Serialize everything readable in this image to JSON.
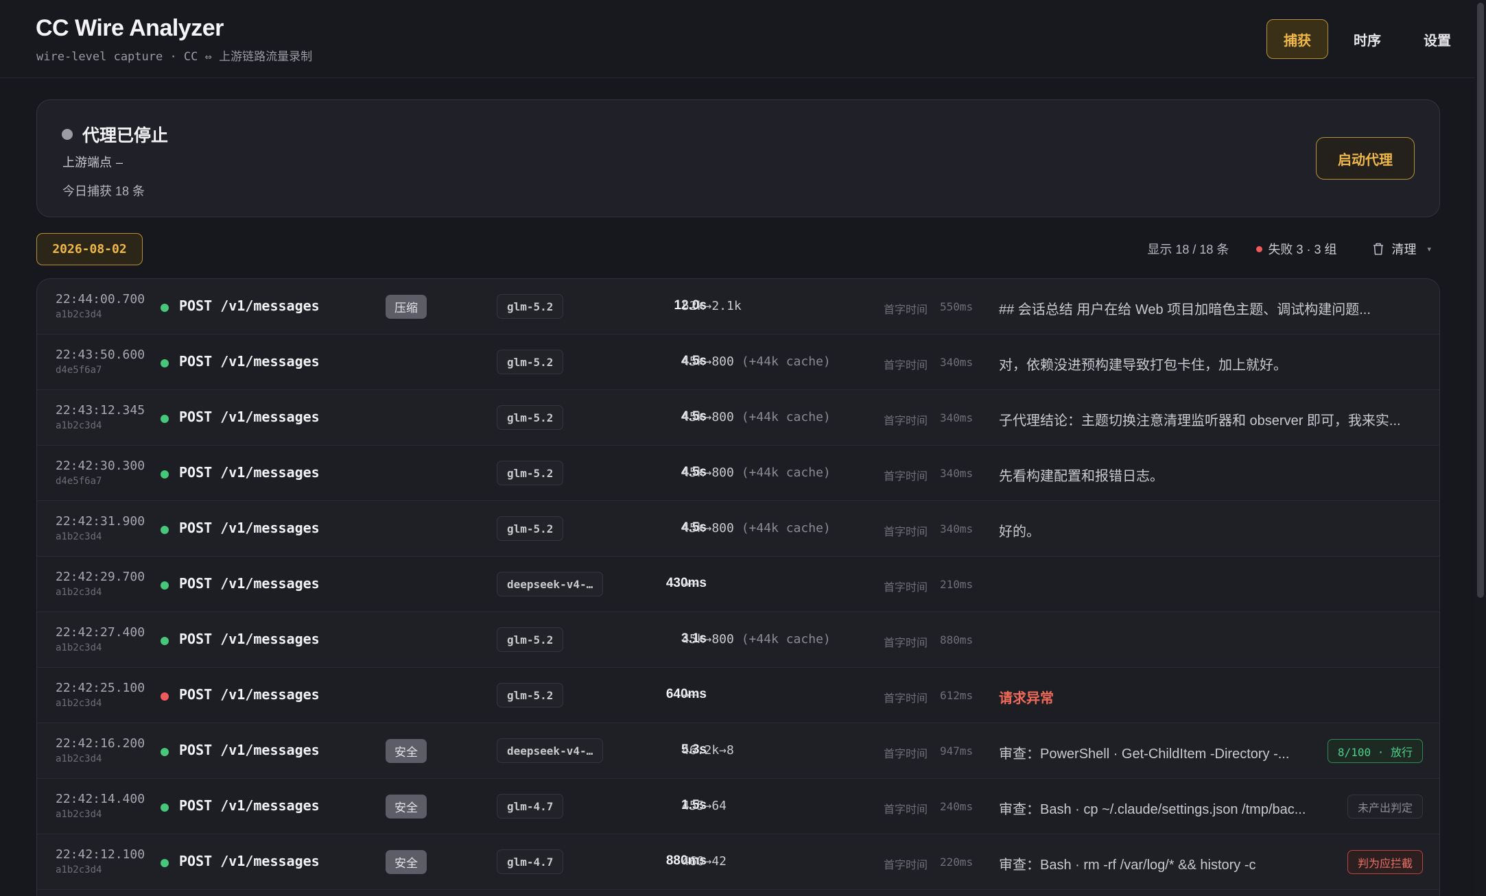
{
  "app": {
    "title": "CC Wire Analyzer",
    "subtitle": "wire-level capture · CC ⇔ 上游链路流量录制"
  },
  "nav": {
    "tabs": [
      {
        "label": "捕获",
        "active": true
      },
      {
        "label": "时序",
        "active": false
      },
      {
        "label": "设置",
        "active": false
      }
    ]
  },
  "proxy": {
    "status": "代理已停止",
    "upstream_label": "上游端点",
    "upstream_value": "–",
    "today": "今日捕获 18 条",
    "start_label": "启动代理"
  },
  "toolbar": {
    "date": "2026-08-02",
    "showing": "显示 18 / 18 条",
    "fail": "失败 3 · 3 组",
    "clear": "清理"
  },
  "table": {
    "ttft_label": "首字时间",
    "rows": [
      {
        "time": "22:44:00.700",
        "id": "a1b2c3d4",
        "status": "ok",
        "method": "POST /v1/messages",
        "tag": "压缩",
        "model": "glm-5.2",
        "duration": "12.0s",
        "tokens": "52k→2.1k",
        "cache": "",
        "ttft": "550ms",
        "summary": "## 会话总结 用户在给 Web 项目加暗色主题、调试构建问题...",
        "summary_error": false,
        "verdict": "",
        "verdict_kind": ""
      },
      {
        "time": "22:43:50.600",
        "id": "d4e5f6a7",
        "status": "ok",
        "method": "POST /v1/messages",
        "tag": "",
        "model": "glm-5.2",
        "duration": "4.5s",
        "tokens": "45k→800",
        "cache": "(+44k cache)",
        "ttft": "340ms",
        "summary": "对，依赖没进预构建导致打包卡住，加上就好。",
        "summary_error": false,
        "verdict": "",
        "verdict_kind": ""
      },
      {
        "time": "22:43:12.345",
        "id": "a1b2c3d4",
        "status": "ok",
        "method": "POST /v1/messages",
        "tag": "",
        "model": "glm-5.2",
        "duration": "4.5s",
        "tokens": "45k→800",
        "cache": "(+44k cache)",
        "ttft": "340ms",
        "summary": "子代理结论：主题切换注意清理监听器和 observer 即可，我来实...",
        "summary_error": false,
        "verdict": "",
        "verdict_kind": ""
      },
      {
        "time": "22:42:30.300",
        "id": "d4e5f6a7",
        "status": "ok",
        "method": "POST /v1/messages",
        "tag": "",
        "model": "glm-5.2",
        "duration": "4.5s",
        "tokens": "45k→800",
        "cache": "(+44k cache)",
        "ttft": "340ms",
        "summary": "先看构建配置和报错日志。",
        "summary_error": false,
        "verdict": "",
        "verdict_kind": ""
      },
      {
        "time": "22:42:31.900",
        "id": "a1b2c3d4",
        "status": "ok",
        "method": "POST /v1/messages",
        "tag": "",
        "model": "glm-5.2",
        "duration": "4.5s",
        "tokens": "45k→800",
        "cache": "(+44k cache)",
        "ttft": "340ms",
        "summary": "好的。",
        "summary_error": false,
        "verdict": "",
        "verdict_kind": ""
      },
      {
        "time": "22:42:29.700",
        "id": "a1b2c3d4",
        "status": "ok",
        "method": "POST /v1/messages",
        "tag": "",
        "model": "deepseek-v4-…",
        "duration": "430ms",
        "tokens": "→–",
        "cache": "",
        "ttft": "210ms",
        "summary": "",
        "summary_error": false,
        "verdict": "",
        "verdict_kind": ""
      },
      {
        "time": "22:42:27.400",
        "id": "a1b2c3d4",
        "status": "ok",
        "method": "POST /v1/messages",
        "tag": "",
        "model": "glm-5.2",
        "duration": "3.1s",
        "tokens": "45k→800",
        "cache": "(+44k cache)",
        "ttft": "880ms",
        "summary": "",
        "summary_error": false,
        "verdict": "",
        "verdict_kind": ""
      },
      {
        "time": "22:42:25.100",
        "id": "a1b2c3d4",
        "status": "error",
        "method": "POST /v1/messages",
        "tag": "",
        "model": "glm-5.2",
        "duration": "640ms",
        "tokens": "→–",
        "cache": "",
        "ttft": "612ms",
        "summary": "请求异常",
        "summary_error": true,
        "verdict": "",
        "verdict_kind": ""
      },
      {
        "time": "22:42:16.200",
        "id": "a1b2c3d4",
        "status": "ok",
        "method": "POST /v1/messages",
        "tag": "安全",
        "model": "deepseek-v4-…",
        "duration": "5.3s",
        "tokens": "46.2k→8",
        "cache": "",
        "ttft": "947ms",
        "summary": "审查：PowerShell · Get-ChildItem -Directory -...",
        "summary_error": false,
        "verdict": "8/100 · 放行",
        "verdict_kind": "pass"
      },
      {
        "time": "22:42:14.400",
        "id": "a1b2c3d4",
        "status": "ok",
        "method": "POST /v1/messages",
        "tag": "安全",
        "model": "glm-4.7",
        "duration": "1.5s",
        "tokens": "455→64",
        "cache": "",
        "ttft": "240ms",
        "summary": "审查：Bash · cp ~/.claude/settings.json /tmp/bac...",
        "summary_error": false,
        "verdict": "未产出判定",
        "verdict_kind": "none"
      },
      {
        "time": "22:42:12.100",
        "id": "a1b2c3d4",
        "status": "ok",
        "method": "POST /v1/messages",
        "tag": "安全",
        "model": "glm-4.7",
        "duration": "880ms",
        "tokens": "460→42",
        "cache": "",
        "ttft": "220ms",
        "summary": "审查：Bash · rm -rf /var/log/* && history -c",
        "summary_error": false,
        "verdict": "判为应拦截",
        "verdict_kind": "block"
      }
    ]
  }
}
